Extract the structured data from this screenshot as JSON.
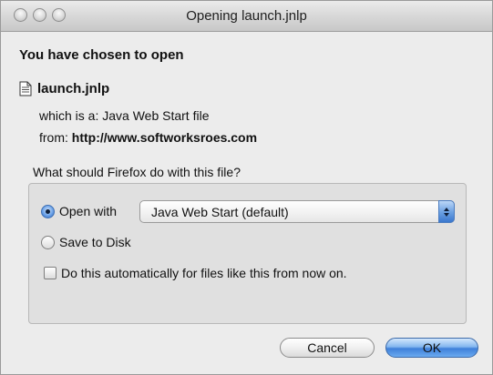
{
  "window": {
    "title": "Opening launch.jnlp"
  },
  "dialog": {
    "heading": "You have chosen to open",
    "file_name": "launch.jnlp",
    "file_type_label": "which is a: ",
    "file_type": "Java Web Start file",
    "from_label": "from: ",
    "from_url": "http://www.softworksroes.com",
    "question": "What should Firefox do with this file?"
  },
  "options": {
    "open_with_label": "Open with",
    "open_with_selected": true,
    "open_with_app": "Java Web Start (default)",
    "save_label": "Save to Disk",
    "save_selected": false,
    "auto_label": "Do this automatically for files like this from now on.",
    "auto_checked": false
  },
  "buttons": {
    "cancel": "Cancel",
    "ok": "OK"
  },
  "colors": {
    "accent": "#3f80da",
    "window_bg": "#ececec"
  }
}
